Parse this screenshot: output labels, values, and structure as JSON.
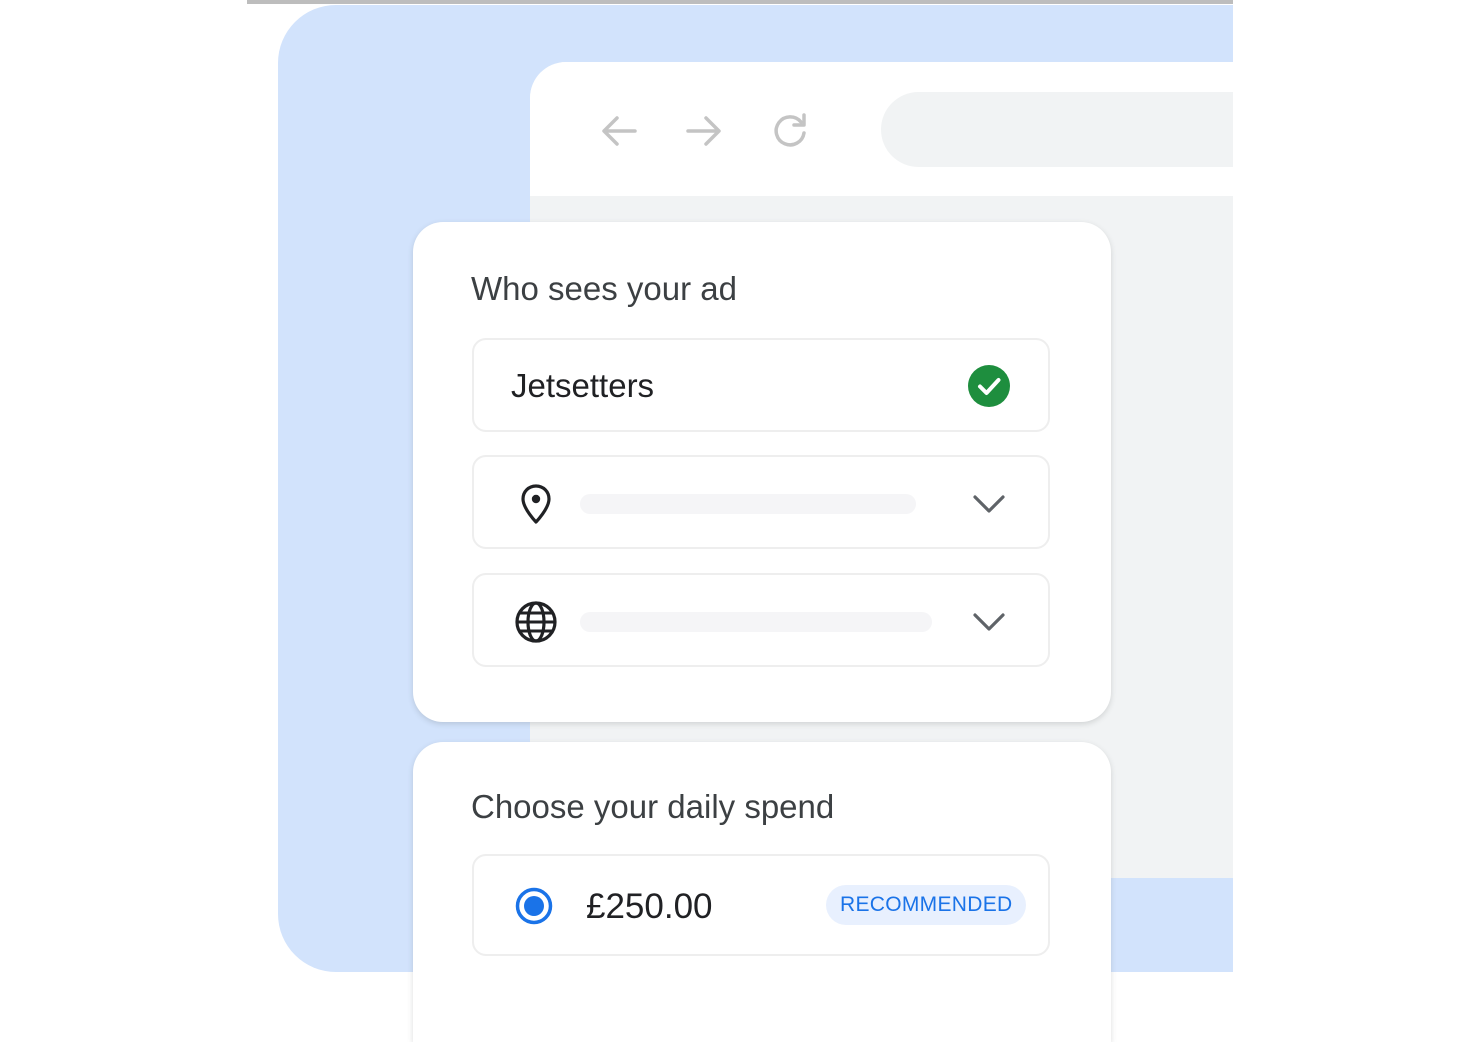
{
  "browser": {
    "icons": {
      "back": "arrow-back-icon",
      "forward": "arrow-forward-icon",
      "reload": "reload-icon"
    }
  },
  "audience": {
    "title": "Who sees your ad",
    "audience_name": "Jetsetters",
    "audience_status_icon": "check-circle-icon",
    "location_icon": "location-pin-icon",
    "language_icon": "globe-icon"
  },
  "spend": {
    "title": "Choose your daily spend",
    "options": [
      {
        "amount": "£250.00",
        "badge": "RECOMMENDED",
        "selected": true
      }
    ]
  },
  "colors": {
    "background_panel": "#d2e3fc",
    "accent_blue": "#1a73e8",
    "success_green": "#1e8e3e",
    "badge_bg": "#e8f0fe"
  }
}
